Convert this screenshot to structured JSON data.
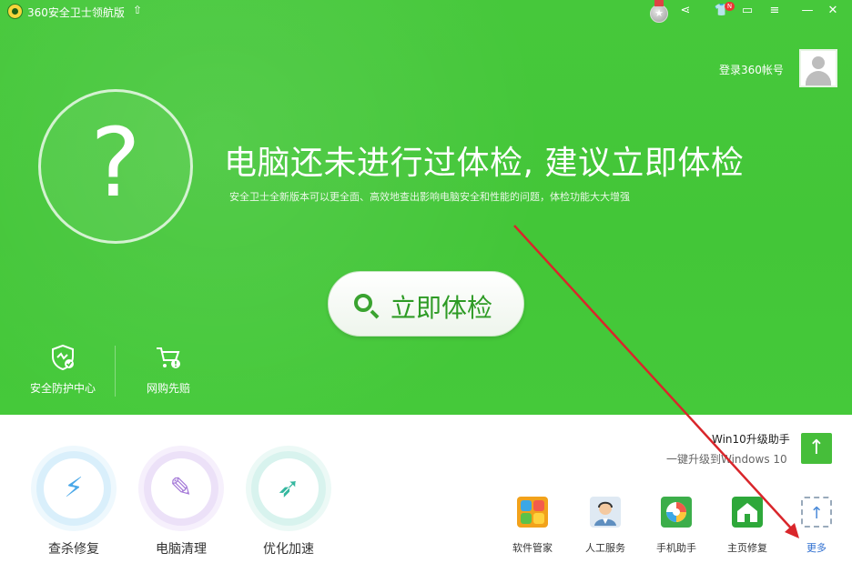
{
  "titlebar": {
    "app_title": "360安全卫士领航版",
    "upgrade_icon": "up-arrow-icon",
    "medal_icon": "medal-icon",
    "share_icon": "share-icon",
    "shirt_icon": "shirt-icon",
    "shirt_badge": "N",
    "feedback_icon": "message-icon",
    "menu_icon": "menu-icon",
    "minimize_icon": "minimize-icon",
    "close_icon": "close-icon"
  },
  "account": {
    "login_text": "登录360帐号",
    "avatar_icon": "user-avatar-icon"
  },
  "hero": {
    "status_glyph": "?",
    "headline": "电脑还未进行过体检, 建议立即体检",
    "subline": "安全卫士全新版本可以更全面、高效地查出影响电脑安全和性能的问题，体检功能大大增强",
    "check_button_label": "立即体检",
    "check_button_icon": "search-icon"
  },
  "mini_tools": [
    {
      "label": "安全防护中心",
      "icon": "shield-icon"
    },
    {
      "label": "网购先赔",
      "icon": "shopping-cart-icon"
    }
  ],
  "main_tools": [
    {
      "label": "查杀修复",
      "icon": "lightning-icon",
      "color": "#5bb8f0",
      "glyph": "⚡"
    },
    {
      "label": "电脑清理",
      "icon": "broom-icon",
      "color": "#b58ae0",
      "glyph": "🧹"
    },
    {
      "label": "优化加速",
      "icon": "rocket-icon",
      "color": "#4cc6b0",
      "glyph": "🚀"
    }
  ],
  "win10": {
    "title": "Win10升级助手",
    "subtitle": "一键升级到Windows 10",
    "button_icon": "up-arrow-icon"
  },
  "apps": [
    {
      "label": "软件管家",
      "icon": "software-manager-icon",
      "color": "#f2a21b",
      "glyph": "88"
    },
    {
      "label": "人工服务",
      "icon": "customer-service-icon",
      "color": "#8db8dc",
      "glyph": "☺"
    },
    {
      "label": "手机助手",
      "icon": "phone-assistant-icon",
      "color": "#3cae4a",
      "glyph": "◉"
    },
    {
      "label": "主页修复",
      "icon": "home-repair-icon",
      "color": "#2ea83a",
      "glyph": "⌂"
    },
    {
      "label": "更多",
      "icon": "more-icon",
      "color": "#4a8ad8",
      "glyph": "↑"
    }
  ],
  "colors": {
    "brand_green": "#43c638",
    "button_green_text": "#2e9b25",
    "annotation_arrow": "#d9262b",
    "more_link": "#2f6fd0"
  }
}
